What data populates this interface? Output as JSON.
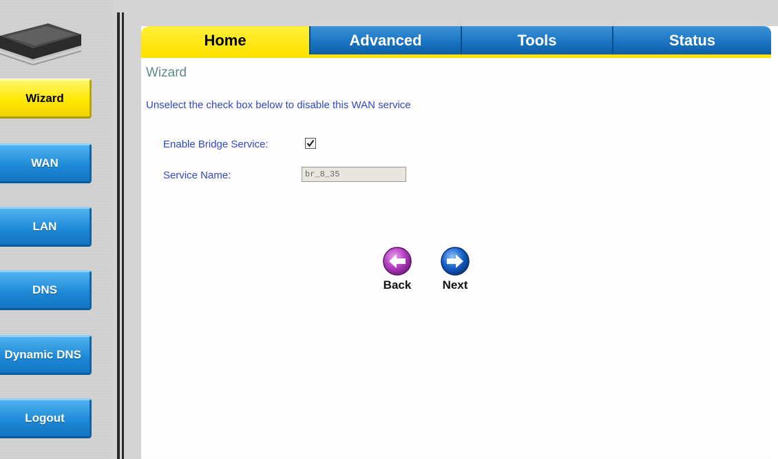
{
  "sidebar": {
    "items": [
      {
        "label": "Wizard",
        "active": true
      },
      {
        "label": "WAN",
        "active": false
      },
      {
        "label": "LAN",
        "active": false
      },
      {
        "label": "DNS",
        "active": false
      },
      {
        "label": "Dynamic DNS",
        "active": false
      },
      {
        "label": "Logout",
        "active": false
      }
    ]
  },
  "tabs": [
    {
      "label": "Home",
      "active": true
    },
    {
      "label": "Advanced",
      "active": false
    },
    {
      "label": "Tools",
      "active": false
    },
    {
      "label": "Status",
      "active": false
    }
  ],
  "page": {
    "title": "Wizard",
    "instruction": "Unselect the check box below to disable this WAN service"
  },
  "form": {
    "bridge_label": "Enable Bridge Service:",
    "bridge_checked": true,
    "service_name_label": "Service Name:",
    "service_name_value": "br_8_35"
  },
  "nav": {
    "back_label": "Back",
    "next_label": "Next",
    "back_icon": "left-arrow-circle-icon",
    "next_icon": "right-arrow-circle-icon"
  },
  "colors": {
    "active_yellow": "#ffe200",
    "tab_blue": "#1872c0",
    "label_blue": "#2f47c9",
    "title_teal": "#5e8c86",
    "back_magenta": "#b23ec0",
    "next_blue": "#1560c8"
  }
}
